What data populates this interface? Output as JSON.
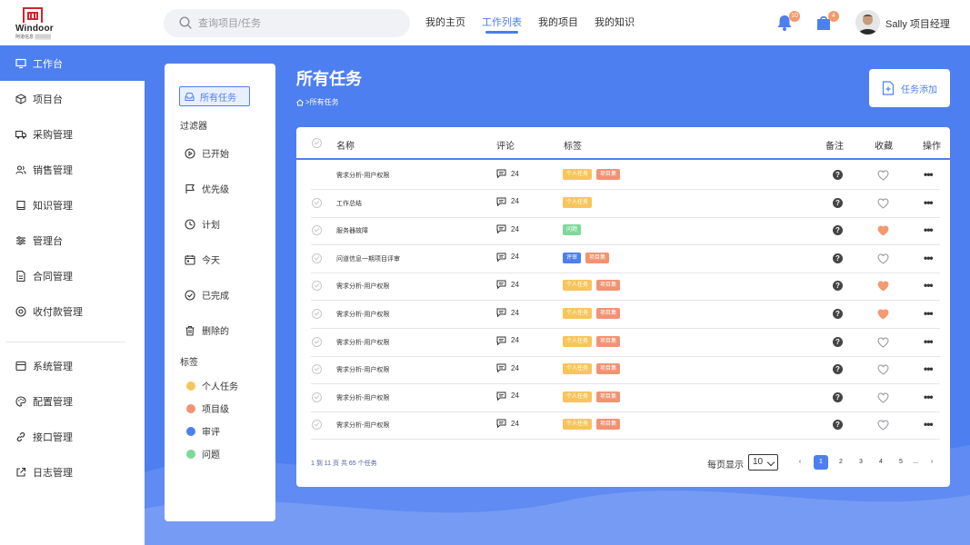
{
  "logo": {
    "name": "Windoor",
    "sub": "阿道信息 ▒▒▒▒▒"
  },
  "search": {
    "placeholder": "查询项目/任务"
  },
  "nav": [
    {
      "label": "我的主页"
    },
    {
      "label": "工作列表"
    },
    {
      "label": "我的项目"
    },
    {
      "label": "我的知识"
    }
  ],
  "notifications": {
    "bell_count": "10",
    "cart_count": "4"
  },
  "user": {
    "name": "Sally 项目经理"
  },
  "sidebar": {
    "items": [
      {
        "label": "工作台",
        "icon": "monitor-icon"
      },
      {
        "label": "项目台",
        "icon": "cube-icon"
      },
      {
        "label": "采购管理",
        "icon": "truck-icon"
      },
      {
        "label": "销售管理",
        "icon": "users-icon"
      },
      {
        "label": "知识管理",
        "icon": "book-icon"
      },
      {
        "label": "管理台",
        "icon": "sliders-icon"
      },
      {
        "label": "合同管理",
        "icon": "document-icon"
      },
      {
        "label": "收付款管理",
        "icon": "target-icon"
      },
      {
        "label": "系统管理",
        "icon": "window-icon"
      },
      {
        "label": "配置管理",
        "icon": "palette-icon"
      },
      {
        "label": "接口管理",
        "icon": "link-icon"
      },
      {
        "label": "日志管理",
        "icon": "external-link-icon"
      }
    ]
  },
  "filter": {
    "all_label": "所有任务",
    "filter_title": "过滤器",
    "items": [
      {
        "label": "已开始"
      },
      {
        "label": "优先级"
      },
      {
        "label": "计划"
      },
      {
        "label": "今天"
      },
      {
        "label": "已完成"
      },
      {
        "label": "删除的"
      }
    ],
    "tag_title": "标签",
    "tags": [
      {
        "label": "个人任务",
        "color": "#f7c55c"
      },
      {
        "label": "项目级",
        "color": "#f19373"
      },
      {
        "label": "审评",
        "color": "#4e7ff0"
      },
      {
        "label": "问题",
        "color": "#7ed89b"
      }
    ]
  },
  "main": {
    "title": "所有任务",
    "breadcrumb": ">所有任务",
    "add_button": "任务添加"
  },
  "table": {
    "headers": {
      "name": "名称",
      "comment": "评论",
      "tag": "标签",
      "note": "备注",
      "fav": "收藏",
      "action": "操作"
    },
    "tag_colors": {
      "个人任务": "#f7c55c",
      "项目集": "#f19373",
      "问题": "#7ed89b",
      "评审": "#4e7ff0"
    },
    "rows": [
      {
        "name": "需求分析-用户权限",
        "comments": "24",
        "tags": [
          "个人任务",
          "项目集"
        ],
        "fav": false,
        "check": false
      },
      {
        "name": "工作总结",
        "comments": "24",
        "tags": [
          "个人任务"
        ],
        "fav": false,
        "check": true
      },
      {
        "name": "服务器故障",
        "comments": "24",
        "tags": [
          "问题"
        ],
        "fav": true,
        "check": true
      },
      {
        "name": "问道信息一期项目评审",
        "comments": "24",
        "tags": [
          "评审",
          "项目集"
        ],
        "fav": false,
        "check": true
      },
      {
        "name": "需求分析-用户权限",
        "comments": "24",
        "tags": [
          "个人任务",
          "项目集"
        ],
        "fav": true,
        "check": true
      },
      {
        "name": "需求分析-用户权限",
        "comments": "24",
        "tags": [
          "个人任务",
          "项目集"
        ],
        "fav": true,
        "check": true
      },
      {
        "name": "需求分析-用户权限",
        "comments": "24",
        "tags": [
          "个人任务",
          "项目集"
        ],
        "fav": false,
        "check": true
      },
      {
        "name": "需求分析-用户权限",
        "comments": "24",
        "tags": [
          "个人任务",
          "项目集"
        ],
        "fav": false,
        "check": true
      },
      {
        "name": "需求分析-用户权限",
        "comments": "24",
        "tags": [
          "个人任务",
          "项目集"
        ],
        "fav": false,
        "check": true
      },
      {
        "name": "需求分析-用户权限",
        "comments": "24",
        "tags": [
          "个人任务",
          "项目集"
        ],
        "fav": false,
        "check": true
      }
    ]
  },
  "pagination": {
    "summary": "1 到 11 页 共 65 个任务",
    "per_page_label": "每页显示",
    "per_page_value": "10",
    "prev": "‹",
    "pages": [
      "1",
      "2",
      "3",
      "4",
      "5"
    ],
    "ellipsis": "...",
    "next": "›",
    "current": "1"
  }
}
